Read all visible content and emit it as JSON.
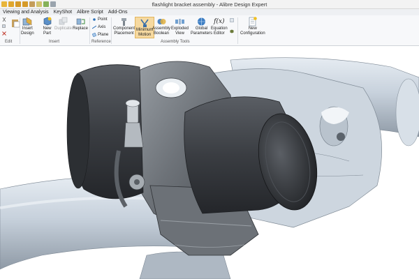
{
  "window": {
    "title": "flashlight bracket assembly - Alibre Design Expert"
  },
  "menubar": {
    "items": [
      "Viewing and Analysis",
      "KeyShot",
      "Alibre Script",
      "Add-Ons"
    ]
  },
  "ribbon": {
    "groups": {
      "edit": "Edit",
      "insert": "Insert",
      "reference": "Reference",
      "assembly_tools": "Assembly Tools"
    },
    "insert_design": "Insert\nDesign",
    "new_part": "New\nPart",
    "duplicate": "Duplicate",
    "replace": "Replace",
    "point": "Point",
    "axis": "Axis",
    "plane": "Plane",
    "component_placement": "Component\nPlacement",
    "minimum_motion": "Minimum\nMotion",
    "assembly_boolean": "Assembly\nBoolean",
    "exploded_view": "Exploded\nView",
    "global_parameters": "Global\nParameters",
    "equation_editor": "Equation\nEditor",
    "equation_glyph": "f(x)",
    "new_configuration": "New\nConfiguration"
  },
  "colors": {
    "accent": "#f6d9a0",
    "viewport_bg": "#ffffff",
    "model_dark": "#3a3d42",
    "model_light": "#c9d3de"
  }
}
